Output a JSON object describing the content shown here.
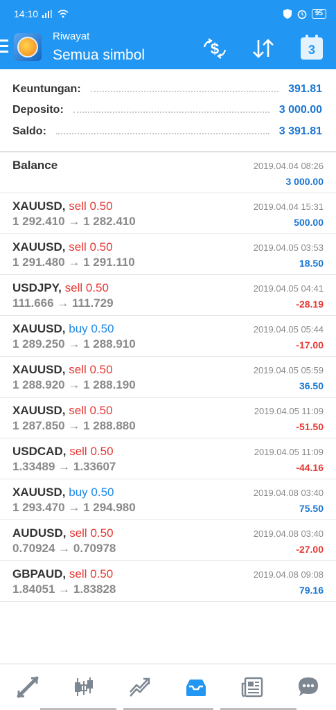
{
  "status": {
    "time": "14:10",
    "battery": "95"
  },
  "header": {
    "subtitle": "Riwayat",
    "title": "Semua simbol",
    "calendar_day": "3"
  },
  "summary": [
    {
      "label": "Keuntungan:",
      "value": "391.81"
    },
    {
      "label": "Deposito:",
      "value": "3 000.00"
    },
    {
      "label": "Saldo:",
      "value": "3 391.81"
    }
  ],
  "balance": {
    "label": "Balance",
    "date": "2019.04.04 08:26",
    "amount": "3 000.00"
  },
  "deals": [
    {
      "symbol": "XAUUSD,",
      "side": "sell",
      "volume": "0.50",
      "prices": "1 292.410 → 1 282.410",
      "date": "2019.04.04 15:31",
      "profit": "500.00",
      "positive": true
    },
    {
      "symbol": "XAUUSD,",
      "side": "sell",
      "volume": "0.50",
      "prices": "1 291.480 → 1 291.110",
      "date": "2019.04.05 03:53",
      "profit": "18.50",
      "positive": true
    },
    {
      "symbol": "USDJPY,",
      "side": "sell",
      "volume": "0.50",
      "prices": "111.666 → 111.729",
      "date": "2019.04.05 04:41",
      "profit": "-28.19",
      "positive": false
    },
    {
      "symbol": "XAUUSD,",
      "side": "buy",
      "volume": "0.50",
      "prices": "1 289.250 → 1 288.910",
      "date": "2019.04.05 05:44",
      "profit": "-17.00",
      "positive": false
    },
    {
      "symbol": "XAUUSD,",
      "side": "sell",
      "volume": "0.50",
      "prices": "1 288.920 → 1 288.190",
      "date": "2019.04.05 05:59",
      "profit": "36.50",
      "positive": true
    },
    {
      "symbol": "XAUUSD,",
      "side": "sell",
      "volume": "0.50",
      "prices": "1 287.850 → 1 288.880",
      "date": "2019.04.05 11:09",
      "profit": "-51.50",
      "positive": false
    },
    {
      "symbol": "USDCAD,",
      "side": "sell",
      "volume": "0.50",
      "prices": "1.33489 → 1.33607",
      "date": "2019.04.05 11:09",
      "profit": "-44.16",
      "positive": false
    },
    {
      "symbol": "XAUUSD,",
      "side": "buy",
      "volume": "0.50",
      "prices": "1 293.470 → 1 294.980",
      "date": "2019.04.08 03:40",
      "profit": "75.50",
      "positive": true
    },
    {
      "symbol": "AUDUSD,",
      "side": "sell",
      "volume": "0.50",
      "prices": "0.70924 → 0.70978",
      "date": "2019.04.08 03:40",
      "profit": "-27.00",
      "positive": false
    },
    {
      "symbol": "GBPAUD,",
      "side": "sell",
      "volume": "0.50",
      "prices": "1.84051 → 1.83828",
      "date": "2019.04.08 09:08",
      "profit": "79.16",
      "positive": true
    }
  ],
  "nav": [
    "quotes-icon",
    "chart-icon",
    "trade-icon",
    "history-icon",
    "news-icon",
    "chat-icon"
  ],
  "colors": {
    "accent": "#2196f3",
    "positive": "#1976d2",
    "negative": "#e53935"
  }
}
